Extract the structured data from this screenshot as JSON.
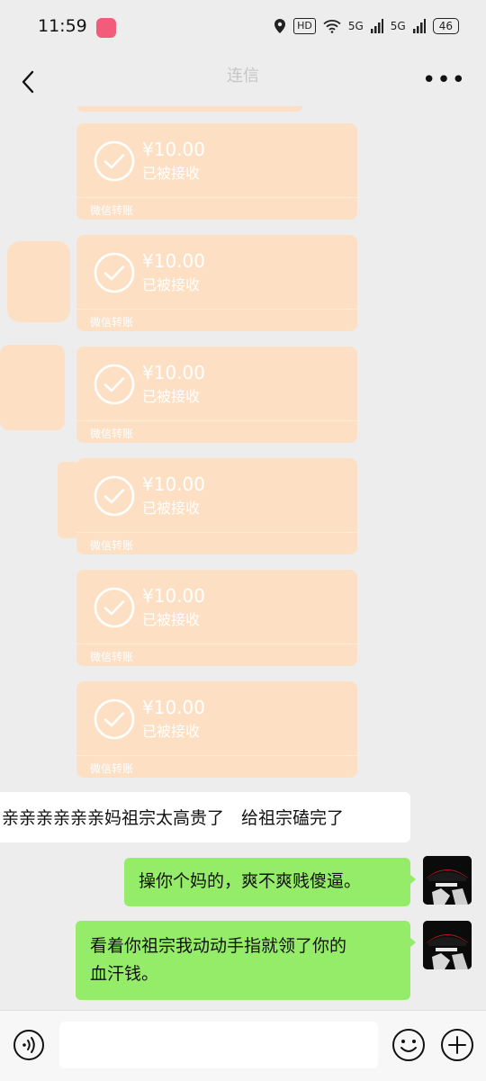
{
  "status_bar": {
    "time": "11:59",
    "hd_badge": "HD",
    "net_1": "5G",
    "net_2": "5G",
    "battery": "46"
  },
  "nav": {
    "title": "连信"
  },
  "transfers": [
    {
      "amount": "¥10.00",
      "status": "已被接收",
      "footer": "微信转账"
    },
    {
      "amount": "¥10.00",
      "status": "已被接收",
      "footer": "微信转账"
    },
    {
      "amount": "¥10.00",
      "status": "已被接收",
      "footer": "微信转账"
    },
    {
      "amount": "¥10.00",
      "status": "已被接收",
      "footer": "微信转账"
    },
    {
      "amount": "¥10.00",
      "status": "已被接收",
      "footer": "微信转账"
    },
    {
      "amount": "¥10.00",
      "status": "已被接收",
      "footer": "微信转账"
    }
  ],
  "messages": {
    "incoming": "亲亲亲亲亲亲妈祖宗太高贵了　给祖宗磕完了",
    "outgoing_1": "操你个妈的，爽不爽贱傻逼。",
    "outgoing_2_line1": "看着你祖宗我动动手指就领了你的",
    "outgoing_2_line2": "血汗钱。"
  },
  "input": {
    "value": ""
  },
  "colors": {
    "transfer_bg": "#fde0c4",
    "outgoing_bubble": "#95ec69",
    "chat_bg": "#ededed"
  }
}
